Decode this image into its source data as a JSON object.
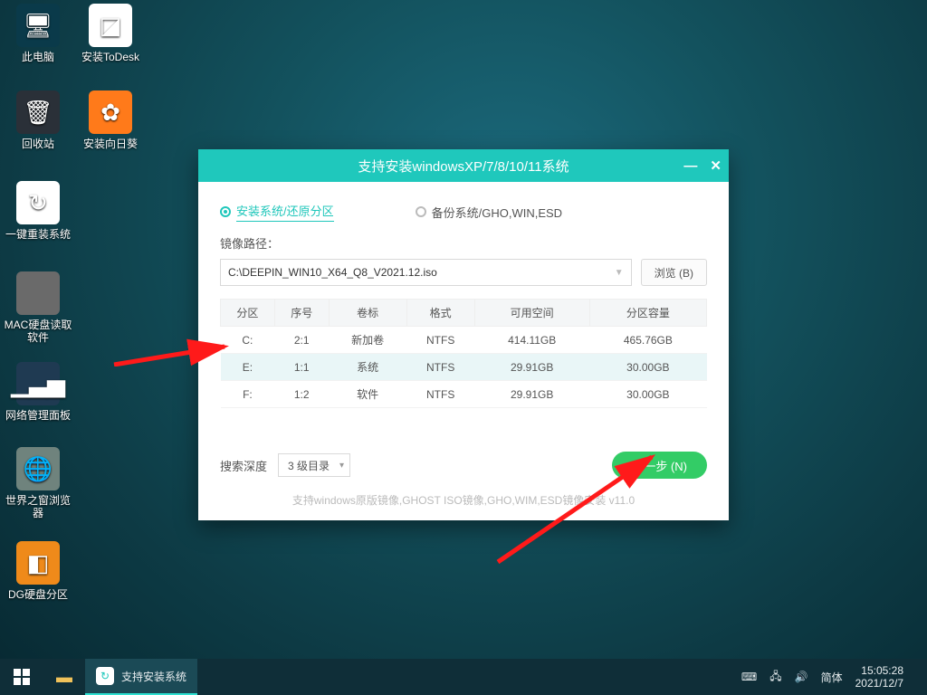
{
  "desktop_icons": {
    "pc": "此电脑",
    "todesk": "安装ToDesk",
    "recycle": "回收站",
    "sunflower": "安装向日葵",
    "reinstall": "一键重装系统",
    "mac": "MAC硬盘读取软件",
    "netpanel": "网络管理面板",
    "browser": "世界之窗浏览器",
    "dg": "DG硬盘分区"
  },
  "window": {
    "title": "支持安装windowsXP/7/8/10/11系统",
    "tab_install": "安装系统/还原分区",
    "tab_backup": "备份系统/GHO,WIN,ESD",
    "image_path_label": "镜像路径：",
    "image_path_value": "C:\\DEEPIN_WIN10_X64_Q8_V2021.12.iso",
    "browse": "浏览 (B)",
    "columns": {
      "part": "分区",
      "seq": "序号",
      "vol": "卷标",
      "fmt": "格式",
      "free": "可用空间",
      "cap": "分区容量"
    },
    "rows": [
      {
        "part": "C:",
        "seq": "2:1",
        "vol": "新加卷",
        "fmt": "NTFS",
        "free": "414.11GB",
        "cap": "465.76GB"
      },
      {
        "part": "E:",
        "seq": "1:1",
        "vol": "系统",
        "fmt": "NTFS",
        "free": "29.91GB",
        "cap": "30.00GB"
      },
      {
        "part": "F:",
        "seq": "1:2",
        "vol": "软件",
        "fmt": "NTFS",
        "free": "29.91GB",
        "cap": "30.00GB"
      }
    ],
    "search_depth_label": "搜索深度",
    "search_depth_value": "3 级目录",
    "next": "下一步 (N)",
    "hint": "支持windows原版镜像,GHOST ISO镜像,GHO,WIM,ESD镜像安装    v11.0"
  },
  "taskbar": {
    "task_label": "支持安装系统",
    "ime": "简体",
    "time": "15:05:28",
    "date": "2021/12/7"
  }
}
